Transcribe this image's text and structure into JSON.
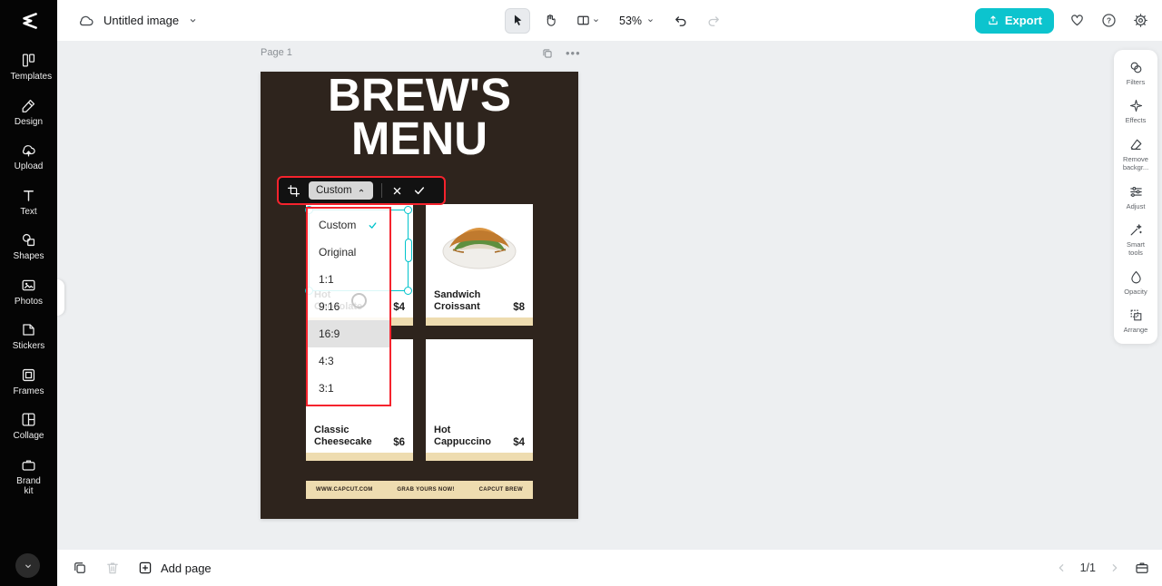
{
  "app": {
    "title": "Untitled image",
    "zoom": "53%",
    "export_label": "Export",
    "page_label": "Page 1",
    "page_indicator": "1/1",
    "add_page_label": "Add page"
  },
  "sidebar": {
    "items": [
      {
        "label": "Templates",
        "icon": "templates-icon"
      },
      {
        "label": "Design",
        "icon": "design-icon"
      },
      {
        "label": "Upload",
        "icon": "upload-icon"
      },
      {
        "label": "Text",
        "icon": "text-icon"
      },
      {
        "label": "Shapes",
        "icon": "shapes-icon"
      },
      {
        "label": "Photos",
        "icon": "photos-icon"
      },
      {
        "label": "Stickers",
        "icon": "stickers-icon"
      },
      {
        "label": "Frames",
        "icon": "frames-icon"
      },
      {
        "label": "Collage",
        "icon": "collage-icon"
      },
      {
        "label": "Brand kit",
        "icon": "brand-kit-icon"
      }
    ]
  },
  "right_panel": {
    "items": [
      {
        "label": "Filters"
      },
      {
        "label": "Effects"
      },
      {
        "label": "Remove backgr..."
      },
      {
        "label": "Adjust"
      },
      {
        "label": "Smart tools"
      },
      {
        "label": "Opacity"
      },
      {
        "label": "Arrange"
      }
    ]
  },
  "crop": {
    "ratio_label": "Custom",
    "menu_items": [
      {
        "label": "Custom",
        "selected": true
      },
      {
        "label": "Original",
        "selected": false
      },
      {
        "label": "1:1",
        "selected": false
      },
      {
        "label": "9:16",
        "selected": false
      },
      {
        "label": "16:9",
        "selected": false,
        "highlighted": true
      },
      {
        "label": "4:3",
        "selected": false
      },
      {
        "label": "3:1",
        "selected": false
      }
    ]
  },
  "design": {
    "title_line1": "BREW'S",
    "title_line2": "MENU",
    "cards": [
      {
        "name": "Hot Chocolate",
        "price": "$4"
      },
      {
        "name": "Sandwich Croissant",
        "price": "$8"
      },
      {
        "name": "Classic Cheesecake",
        "price": "$6"
      },
      {
        "name": "Hot Cappuccino",
        "price": "$4"
      }
    ],
    "footer": {
      "left": "WWW.CAPCUT.COM",
      "center": "GRAB YOURS NOW!",
      "right": "CAPCUT BREW"
    }
  },
  "colors": {
    "accent_cyan": "#0cc4ce",
    "selection_cyan": "#00c4cc",
    "annotation_red": "#f5232d",
    "design_bg": "#2e241d",
    "tan": "#eedcb0"
  }
}
